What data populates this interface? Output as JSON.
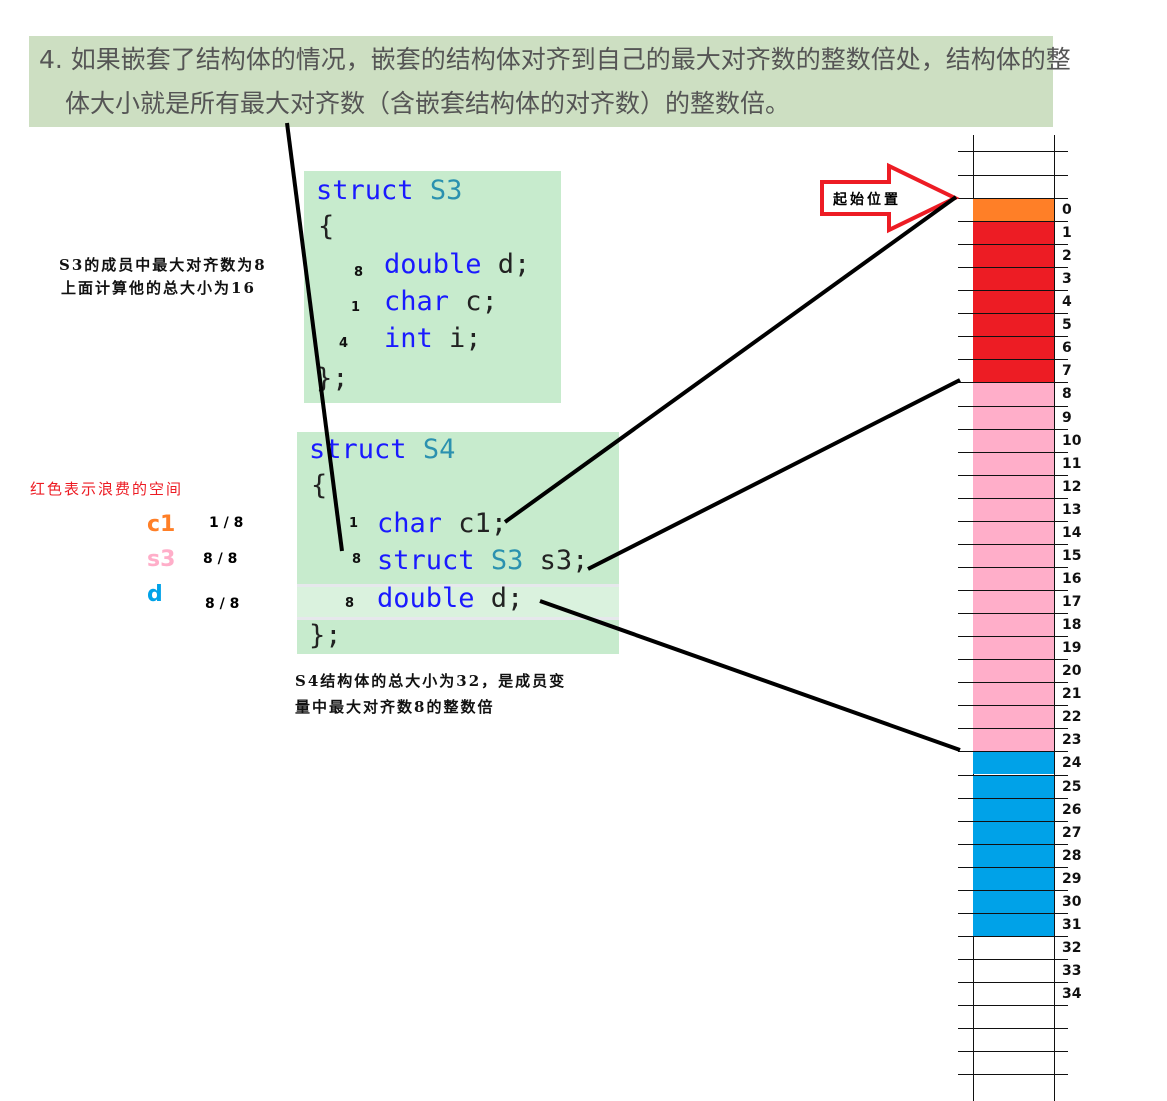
{
  "rule": {
    "line1": "4. 如果嵌套了结构体的情况，嵌套的结构体对齐到自己的最大对齐数的整数倍处，结构体的整",
    "line2": "体大小就是所有最大对齐数（含嵌套结构体的对齐数）的整数倍。"
  },
  "s3": {
    "kw": "struct",
    "name": "S3",
    "open": "{",
    "close": "};",
    "members": [
      {
        "align": "8",
        "type": "double",
        "field": " d;"
      },
      {
        "align": "1",
        "type": "char",
        "field": " c;"
      },
      {
        "align": "4",
        "type": "int",
        "field": " i;"
      }
    ]
  },
  "s4": {
    "kw": "struct",
    "name": "S4",
    "open": "{",
    "close": "};",
    "members": [
      {
        "align": "1",
        "type": "char",
        "field": " c1;"
      },
      {
        "align": "8",
        "type": "struct",
        "type2": "S3",
        "field": " s3;"
      },
      {
        "align": "8",
        "type": "double",
        "field": " d;"
      }
    ]
  },
  "notes": {
    "s3_line1": "S3的成员中最大对齐数为8",
    "s3_line2": "上面计算他的总大小为16",
    "waste": "红色表示浪费的空间",
    "s4_line1": "S4结构体的总大小为32，是成员变",
    "s4_line2": "量中最大对齐数8的整数倍"
  },
  "legend": [
    {
      "name": "c1",
      "value": "1 / 8",
      "color": "#ff7f27"
    },
    {
      "name": "s3",
      "value": "8 / 8",
      "color": "#ffaec9"
    },
    {
      "name": "d",
      "value": "8 / 8",
      "color": "#00a2e8"
    }
  ],
  "start_label": "起始位置",
  "colors": {
    "waste": "#ed1c24",
    "c1": "#ff7f27",
    "s3": "#ffaec9",
    "d": "#00a2e8",
    "arrow": "#ed1c24",
    "code_bg": "#c7ebcd"
  },
  "memory": {
    "indices": [
      "0",
      "1",
      "2",
      "3",
      "4",
      "5",
      "6",
      "7",
      "8",
      "9",
      "10",
      "11",
      "12",
      "13",
      "14",
      "15",
      "16",
      "17",
      "18",
      "19",
      "20",
      "21",
      "22",
      "23",
      "24",
      "25",
      "26",
      "27",
      "28",
      "29",
      "30",
      "31",
      "32",
      "33",
      "34"
    ],
    "fill": [
      "c1",
      "waste",
      "waste",
      "waste",
      "waste",
      "waste",
      "waste",
      "waste",
      "s3",
      "s3",
      "s3",
      "s3",
      "s3",
      "s3",
      "s3",
      "s3",
      "s3",
      "s3",
      "s3",
      "s3",
      "s3",
      "s3",
      "s3",
      "s3",
      "d",
      "d",
      "d",
      "d",
      "d",
      "d",
      "d",
      "d",
      "",
      "",
      ""
    ]
  }
}
